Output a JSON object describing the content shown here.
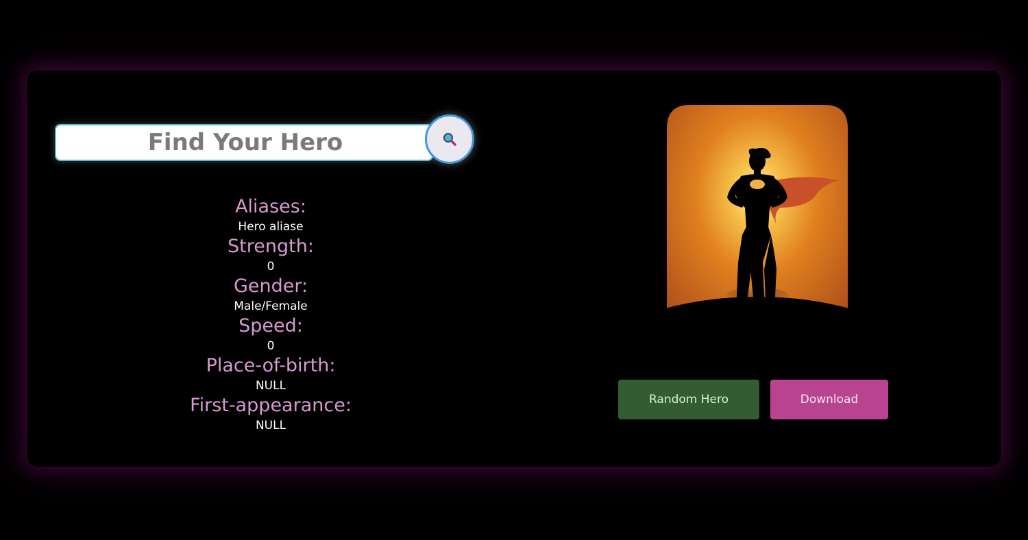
{
  "search": {
    "placeholder": "Find Your Hero",
    "button_icon": "magnifier-icon"
  },
  "hero_info": [
    {
      "label": "Aliases:",
      "value": "Hero aliase"
    },
    {
      "label": "Strength:",
      "value": "0"
    },
    {
      "label": "Gender:",
      "value": "Male/Female"
    },
    {
      "label": "Speed:",
      "value": "0"
    },
    {
      "label": "Place-of-birth:",
      "value": "NULL"
    },
    {
      "label": "First-appearance:",
      "value": "NULL"
    }
  ],
  "hero_image": {
    "icon": "superhero-silhouette",
    "colors": {
      "glow": "#f7d27a",
      "background": "#d06a1e",
      "silhouette": "#000000",
      "cape": "#c8502a"
    }
  },
  "actions": {
    "random_label": "Random Hero",
    "download_label": "Download"
  },
  "colors": {
    "label": "#d79ad2",
    "value": "#ffffff",
    "random_button": "#335c33",
    "download_button": "#b74391",
    "card_glow": "#82146e"
  }
}
